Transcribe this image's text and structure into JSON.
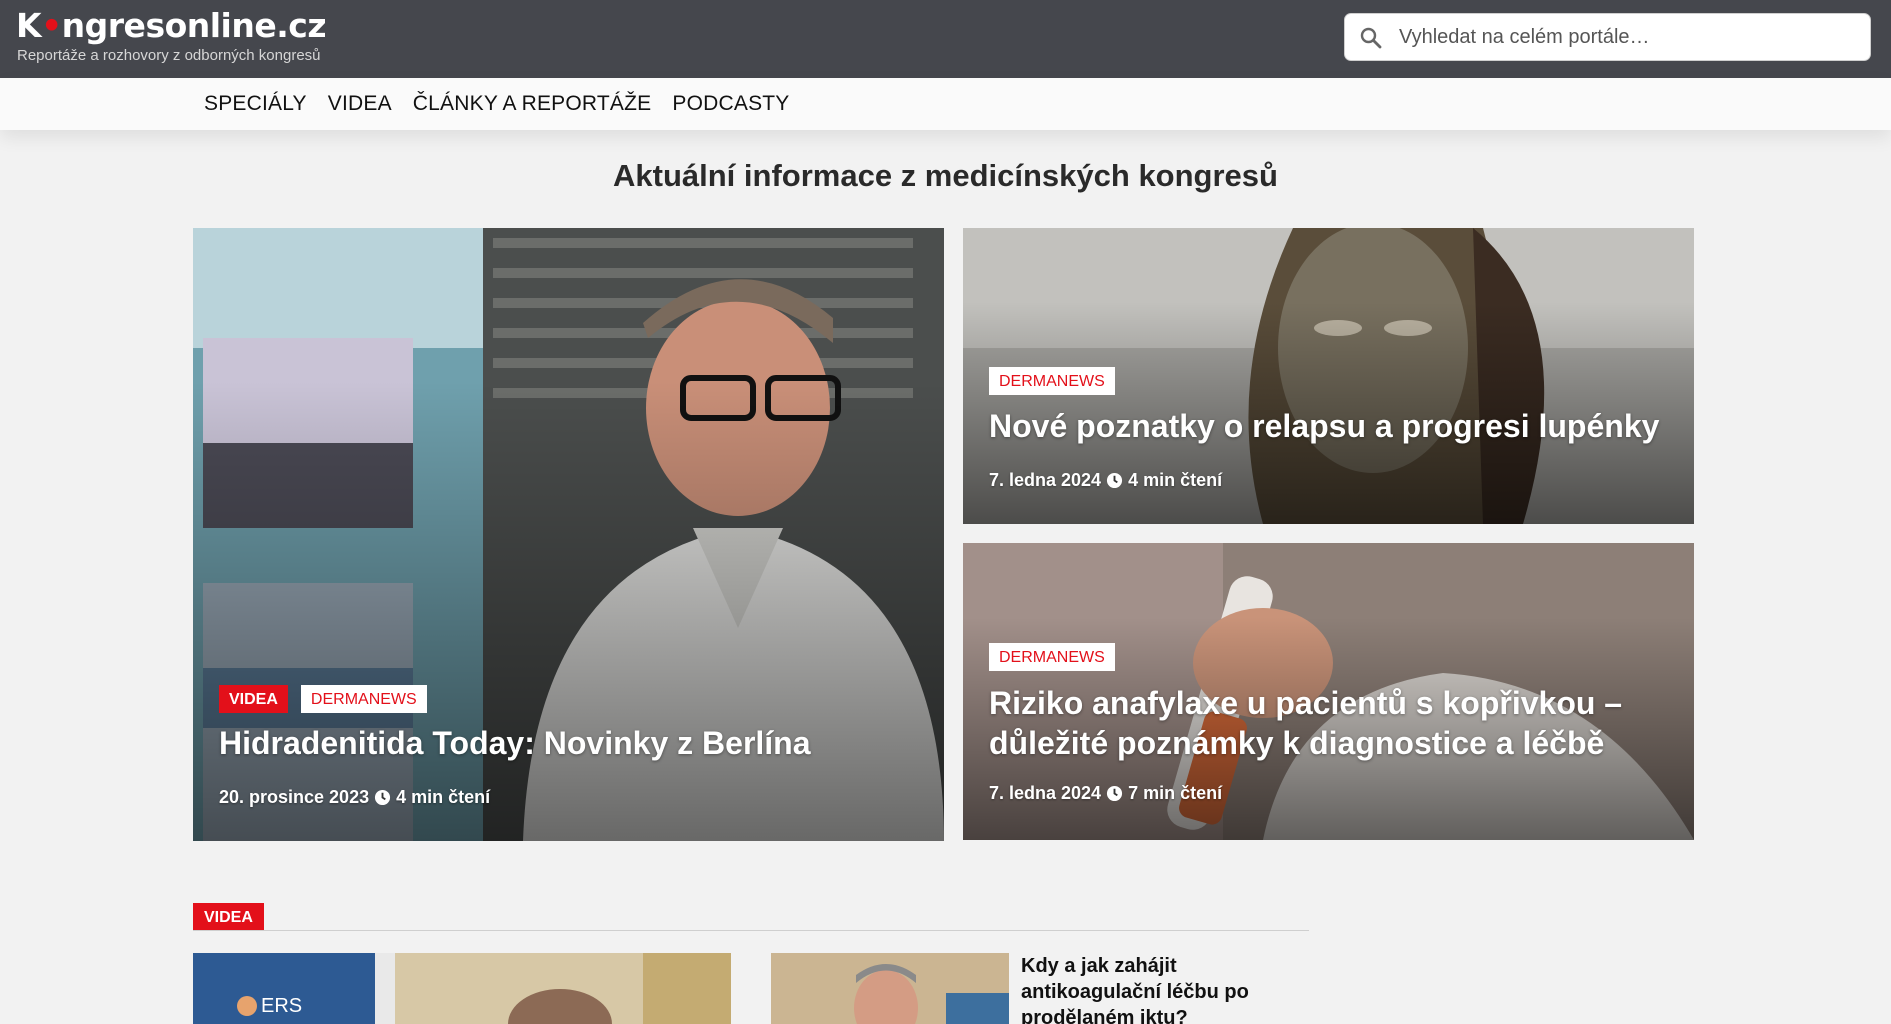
{
  "header": {
    "logo_text": "Kongresonline.cz",
    "logo_part1": "K",
    "logo_part2": "ngresonline.cz",
    "tagline": "Reportáže a rozhovory z odborných kongresů",
    "search_placeholder": "Vyhledat na celém portále…",
    "search_icon": "search-icon"
  },
  "nav": {
    "items": [
      {
        "label": "SPECIÁLY"
      },
      {
        "label": "VIDEA"
      },
      {
        "label": "ČLÁNKY A REPORTÁŽE"
      },
      {
        "label": "PODCASTY"
      }
    ]
  },
  "main": {
    "headline": "Aktuální informace z medicínských kongresů",
    "featured": [
      {
        "badges": [
          "VIDEA",
          "DERMANEWS"
        ],
        "title": "Hidradenitida Today: Novinky z Berlína",
        "date": "20. prosince 2023",
        "reading_time": "4 min čtení"
      },
      {
        "badges": [
          "DERMANEWS"
        ],
        "title": "Nové poznatky o relapsu a progresi lupénky",
        "date": "7. ledna 2024",
        "reading_time": "4 min čtení"
      },
      {
        "badges": [
          "DERMANEWS"
        ],
        "title_line1": "Riziko anafylaxe u pacientů s kopřivkou –",
        "title_line2": "důležité poznámky k diagnostice a léčbě",
        "date": "7. ledna 2024",
        "reading_time": "7 min čtení"
      }
    ]
  },
  "videa_section": {
    "tag": "VIDEA",
    "thumb_label": "ERS",
    "side_article_title": "Kdy a jak zahájit antikoagulační léčbu po prodělaném iktu?"
  },
  "colors": {
    "accent_red": "#e3101a",
    "header_bg": "#45474d",
    "nav_bg": "#fafafa",
    "page_bg": "#f2f2f2"
  }
}
